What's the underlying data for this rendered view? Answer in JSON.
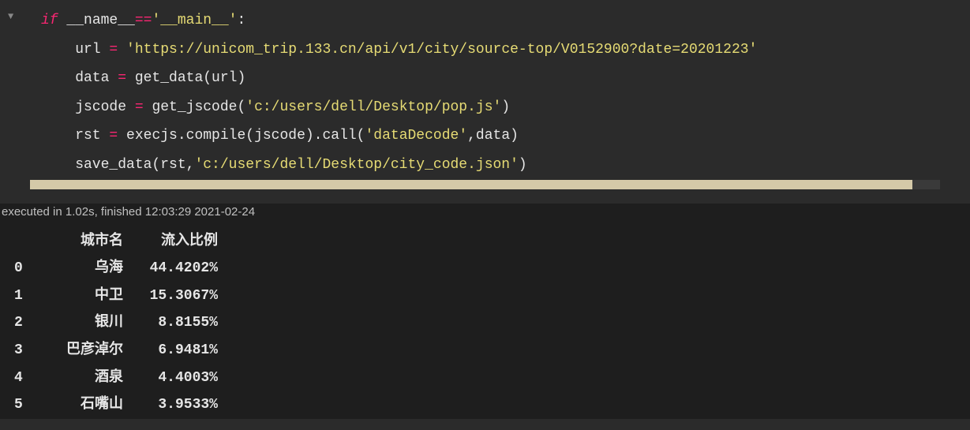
{
  "editor": {
    "fold_marker": "▼",
    "lines": {
      "l1_if": "if",
      "l1_name": " __name__",
      "l1_eq": "==",
      "l1_main": "'__main__'",
      "l1_colon": ":",
      "l2_var": "    url ",
      "l2_eq": "=",
      "l2_str": " 'https://unicom_trip.133.cn/api/v1/city/source-top/V0152900?date=20201223'",
      "l3_var": "    data ",
      "l3_eq": "=",
      "l3_call": " get_data(url)",
      "l4_var": "    jscode ",
      "l4_eq": "=",
      "l4_call1": " get_jscode(",
      "l4_str": "'c:/users/dell/Desktop/pop.js'",
      "l4_call2": ")",
      "l5_var": "    rst ",
      "l5_eq": "=",
      "l5_call1": " execjs.compile(jscode).call(",
      "l5_str": "'dataDecode'",
      "l5_call2": ",data)",
      "l6_call1": "    save_data(rst,",
      "l6_str": "'c:/users/dell/Desktop/city_code.json'",
      "l6_call2": ")"
    }
  },
  "status": {
    "text": "executed in 1.02s, finished 12:03:29 2021-02-24"
  },
  "output": {
    "headers": {
      "city": "城市名",
      "ratio": "流入比例"
    },
    "rows": [
      {
        "idx": "0",
        "city": "乌海",
        "pct": "44.4202%"
      },
      {
        "idx": "1",
        "city": "中卫",
        "pct": "15.3067%"
      },
      {
        "idx": "2",
        "city": "银川",
        "pct": "8.8155%"
      },
      {
        "idx": "3",
        "city": "巴彦淖尔",
        "pct": "6.9481%"
      },
      {
        "idx": "4",
        "city": "酒泉",
        "pct": "4.4003%"
      },
      {
        "idx": "5",
        "city": "石嘴山",
        "pct": "3.9533%"
      }
    ]
  }
}
